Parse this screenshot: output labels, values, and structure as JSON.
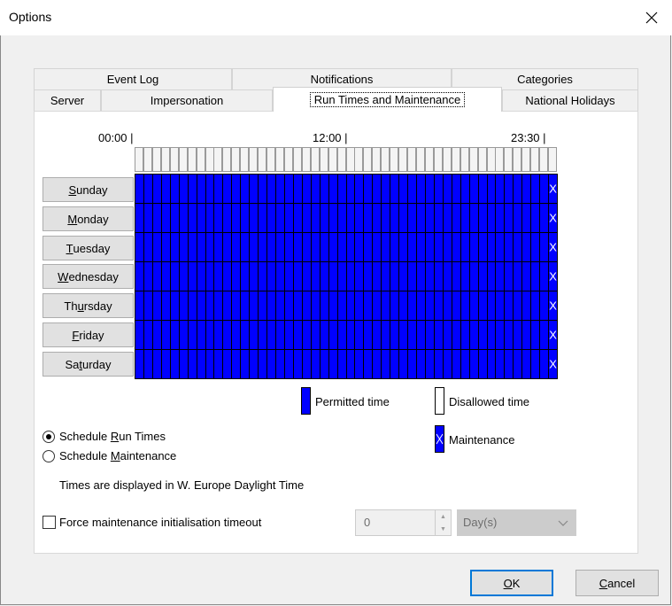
{
  "window": {
    "title": "Options",
    "close_glyph": "✕"
  },
  "tabs_row1": [
    {
      "label": "Event Log"
    },
    {
      "label": "Notifications"
    },
    {
      "label": "Categories"
    }
  ],
  "tabs_row2": [
    {
      "label": "Server"
    },
    {
      "label": "Impersonation"
    },
    {
      "label": "Run Times and Maintenance",
      "active": true
    },
    {
      "label": "National Holidays"
    }
  ],
  "schedule": {
    "time_labels": [
      {
        "label": "00:00"
      },
      {
        "label": "12:00"
      },
      {
        "label": "23:30"
      }
    ],
    "slots_per_day": 48,
    "days": [
      {
        "pre": "",
        "key": "S",
        "post": "unday",
        "label": "Sunday"
      },
      {
        "pre": "",
        "key": "M",
        "post": "onday",
        "label": "Monday"
      },
      {
        "pre": "",
        "key": "T",
        "post": "uesday",
        "label": "Tuesday"
      },
      {
        "pre": "",
        "key": "W",
        "post": "ednesday",
        "label": "Wednesday"
      },
      {
        "pre": "Th",
        "key": "u",
        "post": "rsday",
        "label": "Thursday"
      },
      {
        "pre": "",
        "key": "F",
        "post": "riday",
        "label": "Friday"
      },
      {
        "pre": "Sa",
        "key": "t",
        "post": "urday",
        "label": "Saturday"
      }
    ],
    "permitted_color": "#0000ff",
    "maintenance_slot_index": 47,
    "maintenance_mark": "X"
  },
  "legend": {
    "permitted": "Permitted time",
    "disallowed": "Disallowed time",
    "maintenance": "Maintenance"
  },
  "mode": {
    "run_times": {
      "pre": "Schedule ",
      "key": "R",
      "post": "un Times",
      "selected": true
    },
    "maintenance": {
      "pre": "Schedule ",
      "key": "M",
      "post": "aintenance",
      "selected": false
    }
  },
  "timezone_note": "Times are displayed in W. Europe Daylight Time",
  "force_timeout": {
    "label": "Force maintenance initialisation timeout",
    "checked": false,
    "value": "0",
    "unit": "Day(s)"
  },
  "buttons": {
    "ok": {
      "pre": "",
      "key": "O",
      "post": "K"
    },
    "cancel": {
      "pre": "",
      "key": "C",
      "post": "ancel"
    }
  }
}
